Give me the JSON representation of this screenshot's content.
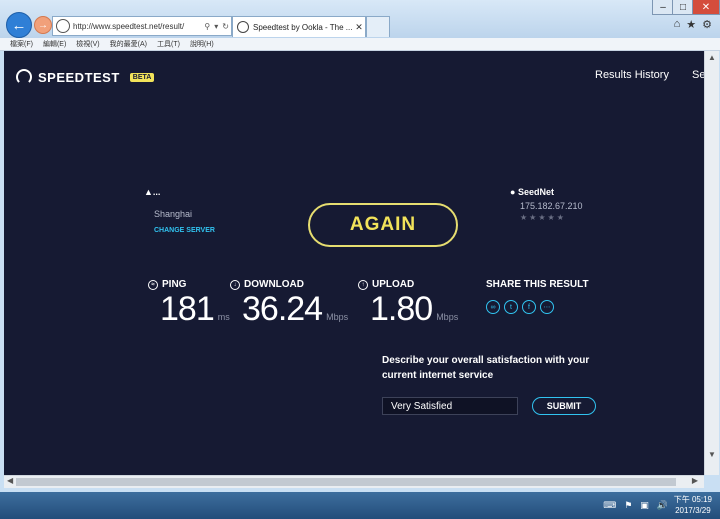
{
  "browser": {
    "address_url": "http://www.speedtest.net/result/",
    "tab_title": "Speedtest by Ookla - The ...",
    "menu": [
      "檔案(F)",
      "編輯(E)",
      "檢視(V)",
      "我的最愛(A)",
      "工具(T)",
      "說明(H)"
    ]
  },
  "speedtest": {
    "logo_text": "SPEEDTEST",
    "logo_badge": "BETA",
    "nav_results_history": "Results History",
    "nav_settings_partial": "Se",
    "server": {
      "name": "...",
      "city": "Shanghai",
      "change_label": "CHANGE SERVER"
    },
    "again_label": "AGAIN",
    "isp": {
      "name": "SeedNet",
      "ip": "175.182.67.210",
      "stars": "★★★★★"
    },
    "ping": {
      "label": "PING",
      "value": "181",
      "unit": "ms"
    },
    "download": {
      "label": "DOWNLOAD",
      "value": "36.24",
      "unit": "Mbps"
    },
    "upload": {
      "label": "UPLOAD",
      "value": "1.80",
      "unit": "Mbps"
    },
    "share": {
      "label": "SHARE THIS RESULT",
      "icons": [
        "link-icon",
        "twitter-icon",
        "facebook-icon",
        "more-icon"
      ]
    },
    "survey": {
      "question": "Describe your overall satisfaction with your current internet service",
      "selected": "Very Satisfied",
      "submit_label": "SUBMIT"
    }
  },
  "taskbar": {
    "time": "下午 05:19",
    "date": "2017/3/29"
  },
  "colors": {
    "page_bg": "#161a33",
    "accent_yellow": "#f2e35a",
    "accent_cyan": "#31c3f0"
  }
}
